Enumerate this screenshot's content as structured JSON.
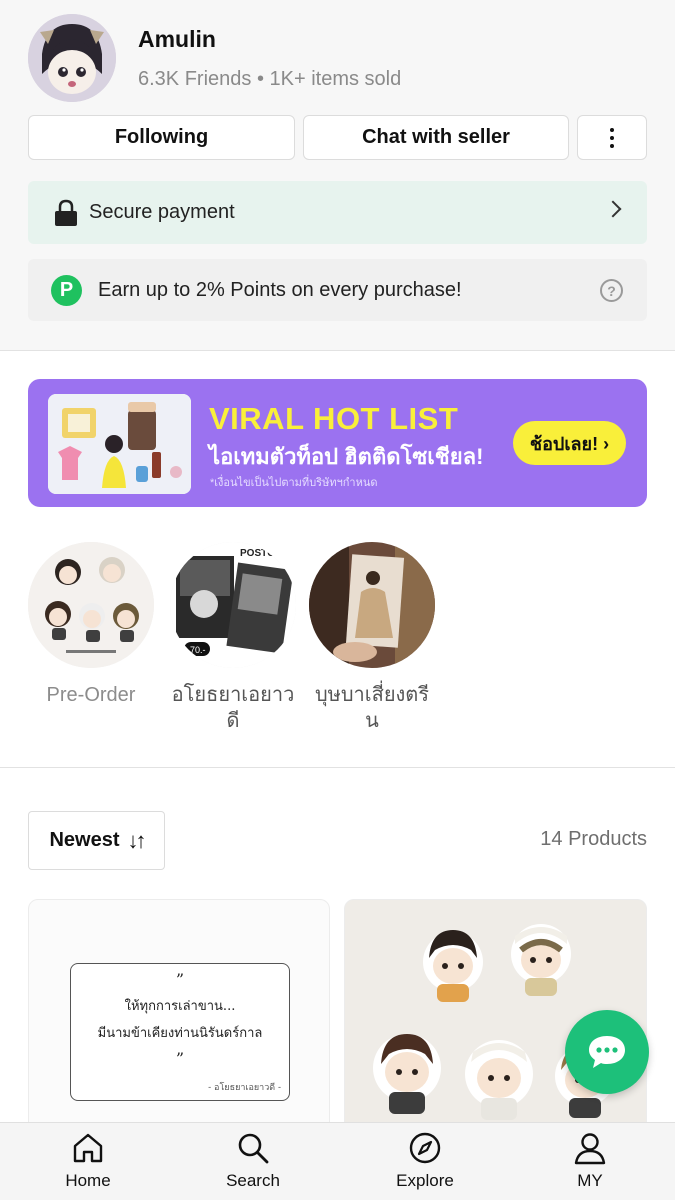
{
  "shop": {
    "name": "Amulin",
    "stats": "6.3K Friends • 1K+ items sold"
  },
  "actions": {
    "follow_label": "Following",
    "chat_label": "Chat with seller"
  },
  "secure": {
    "label": "Secure payment"
  },
  "points": {
    "badge": "P",
    "label": "Earn up to 2% Points on every purchase!",
    "help": "?"
  },
  "banner": {
    "title": "VIRAL HOT LIST",
    "subtitle": "ไอเทมตัวท็อป ฮิตติดโซเชียล!",
    "note": "*เงื่อนไขเป็นไปตามที่บริษัทฯกำหนด",
    "cta": "ช้อปเลย! ›",
    "colors": {
      "background": "#9b72f0",
      "title": "#f9ef3a",
      "cta": "#f9ef3a"
    }
  },
  "stories": [
    {
      "label": "Pre-Order"
    },
    {
      "label": "อโยธยาเอยาวดี"
    },
    {
      "label": "บุษบาเสี่ยงตรีน"
    }
  ],
  "products": {
    "sort_label": "Newest",
    "sort_icon": "↓↑",
    "count_label": "14 Products",
    "card1": {
      "quote_open": "”",
      "line1": "ให้ทุกการเล่าขาน...",
      "line2": "มีนามข้าเคียงท่านนิรันดร์กาล",
      "quote_close": "”",
      "sign": "- อโยธยาเอยาวดี -"
    }
  },
  "nav": {
    "home": "Home",
    "search": "Search",
    "explore": "Explore",
    "my": "MY"
  },
  "colors": {
    "accent_green": "#1dc07a",
    "points_green": "#1fc15f",
    "secure_bg": "#e7f3ee"
  }
}
